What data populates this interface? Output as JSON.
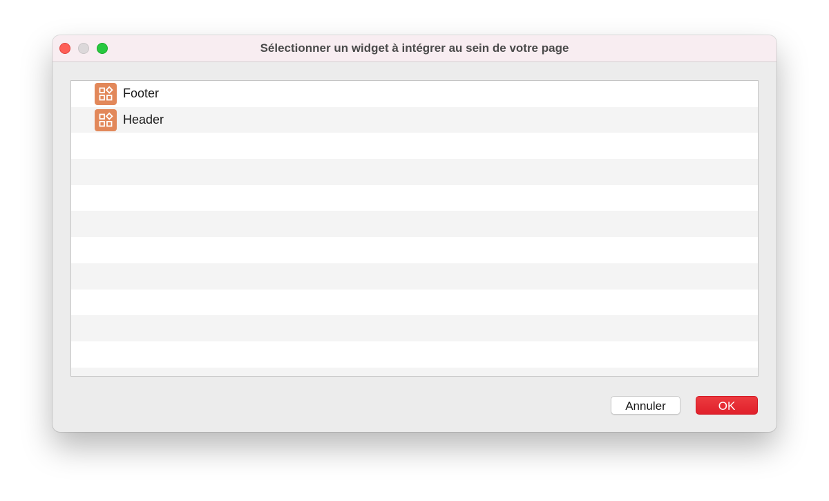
{
  "window": {
    "title": "Sélectionner un widget à intégrer au sein de votre page"
  },
  "list": {
    "items": [
      {
        "label": "Footer",
        "icon": "widgets-icon"
      },
      {
        "label": "Header",
        "icon": "widgets-icon"
      }
    ]
  },
  "buttons": {
    "cancel_label": "Annuler",
    "ok_label": "OK"
  },
  "colors": {
    "accent": "#e2262f",
    "widget_icon": "#e2885a",
    "titlebar": "#f8edf1"
  }
}
